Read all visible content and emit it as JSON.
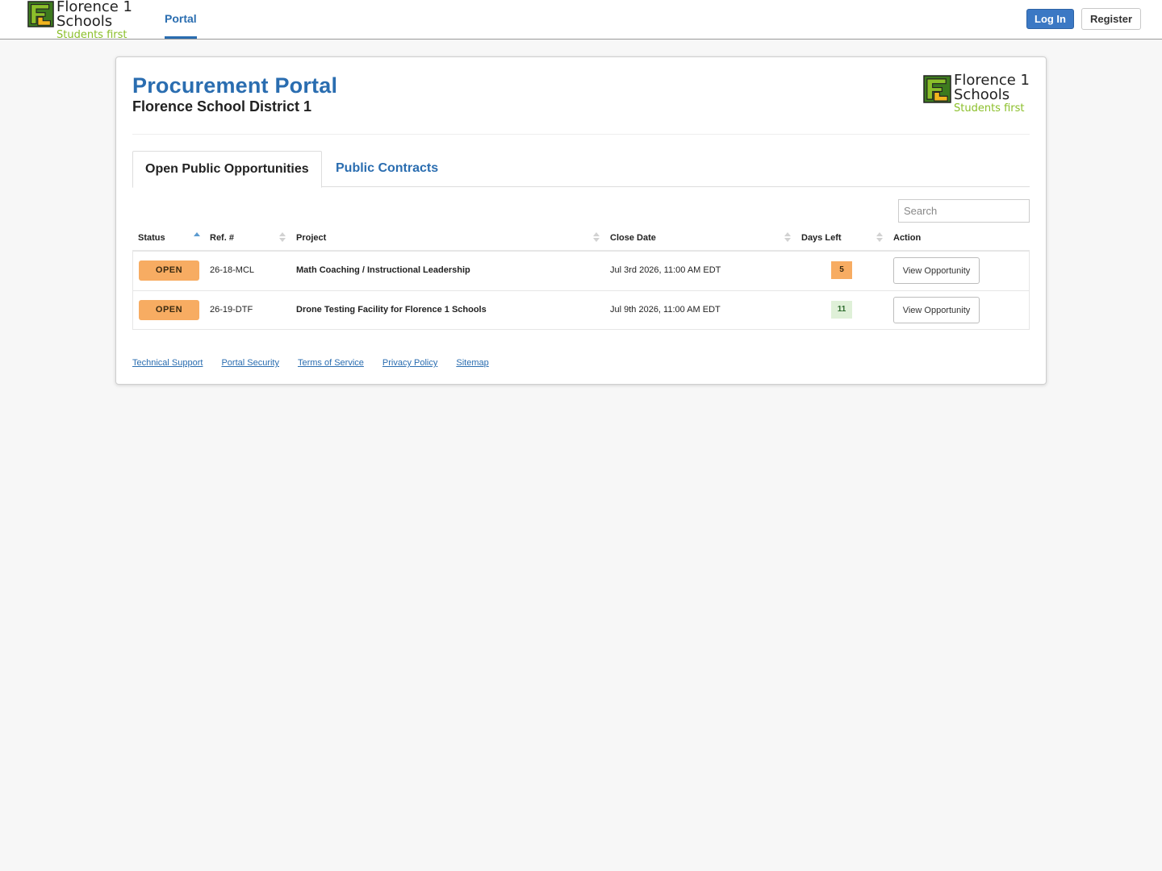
{
  "colors": {
    "brand_blue": "#2a6db0",
    "login_blue": "#3b78c4",
    "open_orange": "#f7ac62",
    "logo_green": "#8bbf2a",
    "logo_yellow": "#f2b51d"
  },
  "logo": {
    "line1": "Florence 1",
    "line2": "Schools",
    "tagline": "Students first"
  },
  "nav": {
    "tab_portal": "Portal",
    "login_label": "Log In",
    "register_label": "Register"
  },
  "portal": {
    "title": "Procurement Portal",
    "subtitle": "Florence School District 1"
  },
  "tabs": {
    "open": "Open Public Opportunities",
    "contracts": "Public Contracts"
  },
  "search": {
    "placeholder": "Search"
  },
  "table": {
    "headers": {
      "status": "Status",
      "ref": "Ref. #",
      "project": "Project",
      "close_date": "Close Date",
      "days_left": "Days Left",
      "action": "Action"
    },
    "rows": [
      {
        "status": "OPEN",
        "ref": "26-18-MCL",
        "project": "Math Coaching / Instructional Leadership",
        "close_date": "Jul 3rd 2026, 11:00 AM EDT",
        "days_left": "5",
        "action": "View Opportunity"
      },
      {
        "status": "OPEN",
        "ref": "26-19-DTF",
        "project": "Drone Testing Facility for Florence 1 Schools",
        "close_date": "Jul 9th 2026, 11:00 AM EDT",
        "days_left": "11",
        "action": "View Opportunity"
      }
    ]
  },
  "footer": {
    "links": [
      "Technical Support",
      "Portal Security",
      "Terms of Service",
      "Privacy Policy",
      "Sitemap"
    ]
  }
}
